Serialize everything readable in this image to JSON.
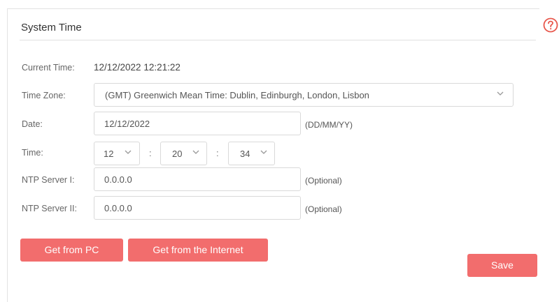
{
  "panel": {
    "title": "System Time",
    "help_icon": "help-circle-icon"
  },
  "form": {
    "current_time": {
      "label": "Current Time:",
      "value": "12/12/2022 12:21:22"
    },
    "time_zone": {
      "label": "Time Zone:",
      "selected": "(GMT) Greenwich Mean Time: Dublin, Edinburgh, London, Lisbon"
    },
    "date": {
      "label": "Date:",
      "value": "12/12/2022",
      "hint": "(DD/MM/YY)"
    },
    "time": {
      "label": "Time:",
      "hour": "12",
      "minute": "20",
      "second": "34",
      "separator": ":"
    },
    "ntp1": {
      "label": "NTP Server I:",
      "value": "0.0.0.0",
      "hint": "(Optional)"
    },
    "ntp2": {
      "label": "NTP Server II:",
      "value": "0.0.0.0",
      "hint": "(Optional)"
    }
  },
  "buttons": {
    "get_from_pc": "Get from PC",
    "get_from_internet": "Get from the Internet",
    "save": "Save"
  },
  "colors": {
    "accent": "#f26d6d",
    "help_icon": "#e8574c"
  }
}
